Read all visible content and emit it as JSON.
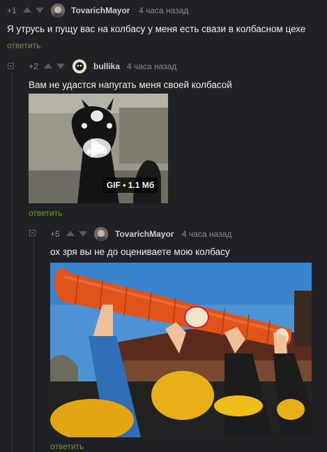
{
  "comments": [
    {
      "rating": "+1",
      "user": "TovarichMayor",
      "time": "4 часа назад",
      "text": "Я утрусь и пущу вас на колбасу у меня есть свази в колбасном цехе",
      "reply": "ответить"
    },
    {
      "rating": "+2",
      "user": "bullika",
      "time": "4 часа назад",
      "text": "Вам не удастся напугать меня своей колбасой",
      "reply": "ответить",
      "media": {
        "type": "GIF",
        "size": "1.1 Мб"
      }
    },
    {
      "rating": "+5",
      "user": "TovarichMayor",
      "time": "4 часа назад",
      "text": "ох зря вы не до оцениваете мою колбасу",
      "reply": "ответить"
    }
  ],
  "colors": {
    "background": "#1f2124",
    "reply": "#6a9a34",
    "text": "#f0f0f0",
    "muted": "#8d8d8d"
  }
}
